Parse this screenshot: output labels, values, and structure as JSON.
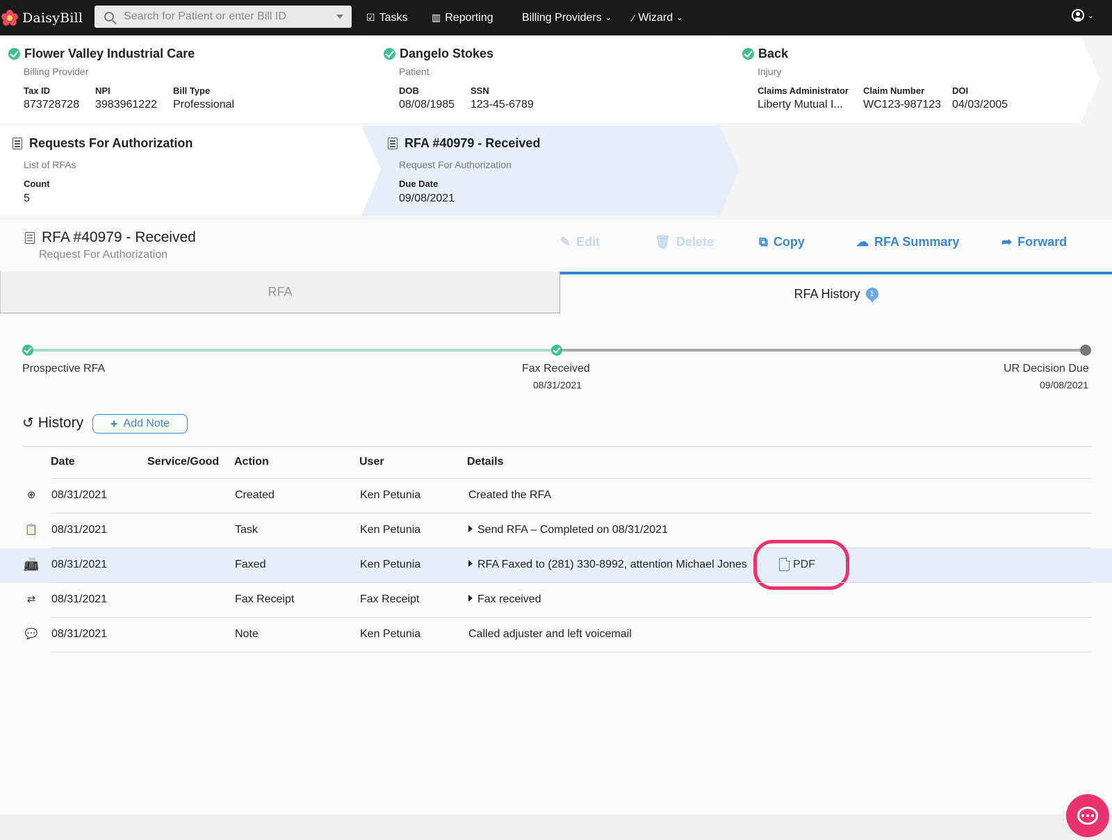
{
  "nav": {
    "brand": "DaisyBill",
    "search_placeholder": "Search for Patient or enter Bill ID",
    "tasks": "Tasks",
    "reporting": "Reporting",
    "billing_providers": "Billing Providers",
    "wizard": "Wizard"
  },
  "crumbs": {
    "provider": {
      "title": "Flower Valley Industrial Care",
      "subtitle": "Billing Provider",
      "fields": [
        {
          "label": "Tax ID",
          "value": "873728728"
        },
        {
          "label": "NPI",
          "value": "3983961222"
        },
        {
          "label": "Bill Type",
          "value": "Professional"
        }
      ]
    },
    "patient": {
      "title": "Dangelo Stokes",
      "subtitle": "Patient",
      "fields": [
        {
          "label": "DOB",
          "value": "08/08/1985"
        },
        {
          "label": "SSN",
          "value": "123-45-6789"
        }
      ]
    },
    "injury": {
      "title": "Back",
      "subtitle": "Injury",
      "fields": [
        {
          "label": "Claims Administrator",
          "value": "Liberty Mutual I..."
        },
        {
          "label": "Claim Number",
          "value": "WC123-987123"
        },
        {
          "label": "DOI",
          "value": "04/03/2005"
        }
      ]
    },
    "rfas": {
      "title": "Requests For Authorization",
      "subtitle": "List of RFAs",
      "fields": [
        {
          "label": "Count",
          "value": "5"
        }
      ]
    },
    "rfa": {
      "title": "RFA #40979 - Received",
      "subtitle": "Request For Authorization",
      "fields": [
        {
          "label": "Due Date",
          "value": "09/08/2021"
        }
      ]
    }
  },
  "page": {
    "title": "RFA #40979 - Received",
    "subtitle": "Request For Authorization",
    "actions": {
      "edit": "Edit",
      "delete": "Delete",
      "copy": "Copy",
      "summary": "RFA Summary",
      "forward": "Forward"
    },
    "tabs": {
      "rfa": "RFA",
      "history": "RFA History",
      "history_badge": "1"
    }
  },
  "timeline": [
    {
      "label": "Prospective RFA",
      "date": "",
      "status": "done"
    },
    {
      "label": "Fax Received",
      "date": "08/31/2021",
      "status": "done"
    },
    {
      "label": "UR Decision Due",
      "date": "09/08/2021",
      "status": "pending"
    }
  ],
  "history": {
    "title": "History",
    "add_note": "Add Note",
    "columns": [
      "Date",
      "Service/Good",
      "Action",
      "User",
      "Details"
    ],
    "rows": [
      {
        "icon": "plus-circle-icon",
        "date": "08/31/2021",
        "service": "",
        "action": "Created",
        "user": "Ken Petunia",
        "details": "Created the RFA",
        "expandable": false
      },
      {
        "icon": "clipboard-icon",
        "date": "08/31/2021",
        "service": "",
        "action": "Task",
        "user": "Ken Petunia",
        "details": "Send RFA – Completed on 08/31/2021",
        "expandable": true
      },
      {
        "icon": "fax-icon",
        "date": "08/31/2021",
        "service": "",
        "action": "Faxed",
        "user": "Ken Petunia",
        "details": "RFA Faxed to (281) 330-8992, attention Michael Jones",
        "expandable": true,
        "link": "PDF"
      },
      {
        "icon": "transfer-icon",
        "date": "08/31/2021",
        "service": "",
        "action": "Fax Receipt",
        "user": "Fax Receipt",
        "details": "Fax received",
        "expandable": true
      },
      {
        "icon": "comment-icon",
        "date": "08/31/2021",
        "service": "",
        "action": "Note",
        "user": "Ken Petunia",
        "details": "Called adjuster and left voicemail",
        "expandable": false
      }
    ]
  },
  "colors": {
    "accent": "#3a86d6",
    "success": "#3fc18f",
    "highlight": "#e8336d",
    "selected_bg": "#e6eefa"
  }
}
